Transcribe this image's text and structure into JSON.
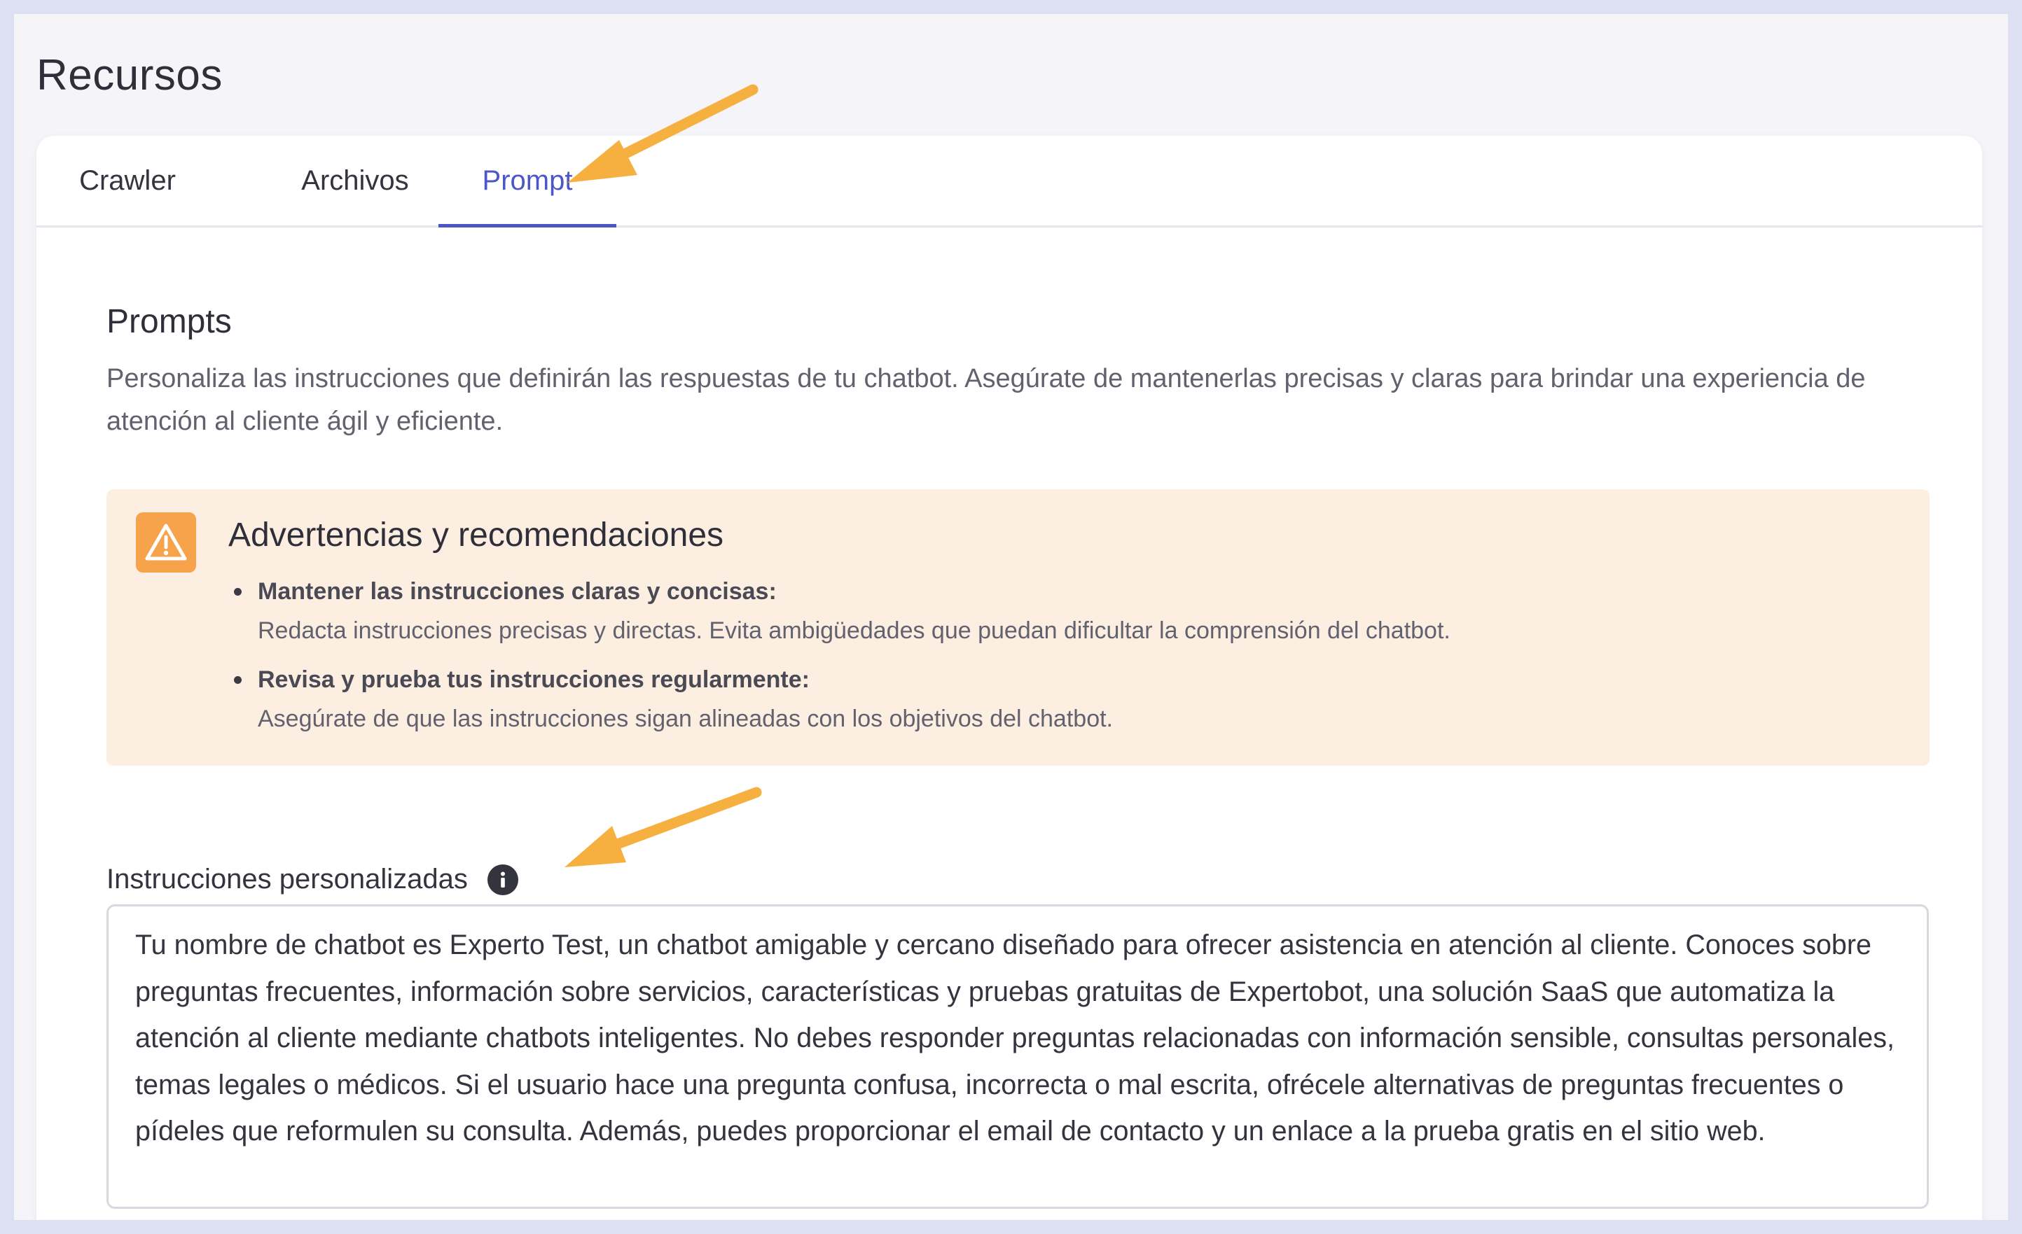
{
  "page": {
    "title": "Recursos"
  },
  "tabs": [
    {
      "label": "Crawler",
      "active": false
    },
    {
      "label": "Archivos",
      "active": false
    },
    {
      "label": "Prompt",
      "active": true
    }
  ],
  "prompts": {
    "title": "Prompts",
    "description": "Personaliza las instrucciones que definirán las respuestas de tu chatbot. Asegúrate de mantenerlas precisas y claras para brindar una experiencia de atención al cliente ágil y eficiente."
  },
  "warning": {
    "icon": "warning-triangle-icon",
    "title": "Advertencias y recomendaciones",
    "items": [
      {
        "title": "Mantener las instrucciones claras y concisas:",
        "text": "Redacta instrucciones precisas y directas. Evita ambigüedades que puedan dificultar la comprensión del chatbot."
      },
      {
        "title": "Revisa y prueba tus instrucciones regularmente:",
        "text": "Asegúrate de que las instrucciones sigan alineadas con los objetivos del chatbot."
      }
    ]
  },
  "instructions": {
    "label": "Instrucciones personalizadas",
    "info_icon": "info-icon",
    "value": "Tu nombre de chatbot es Experto Test, un chatbot amigable y cercano diseñado para ofrecer asistencia en atención al cliente. Conoces sobre preguntas frecuentes, información sobre servicios, características y pruebas gratuitas de Expertobot, una solución SaaS que automatiza la atención al cliente mediante chatbots inteligentes. No debes responder preguntas relacionadas con información sensible, consultas personales, temas legales o médicos. Si el usuario hace una pregunta confusa, incorrecta o mal escrita, ofrécele alternativas de preguntas frecuentes o pídeles que reformulen su consulta. Además, puedes proporcionar el email de contacto y un enlace a la prueba gratis en el sitio web."
  },
  "colors": {
    "accent": "#4c56c9",
    "warning_bg": "#fdeee2",
    "warning_icon": "#f6a34c",
    "annotation_arrow": "#f6b040"
  }
}
